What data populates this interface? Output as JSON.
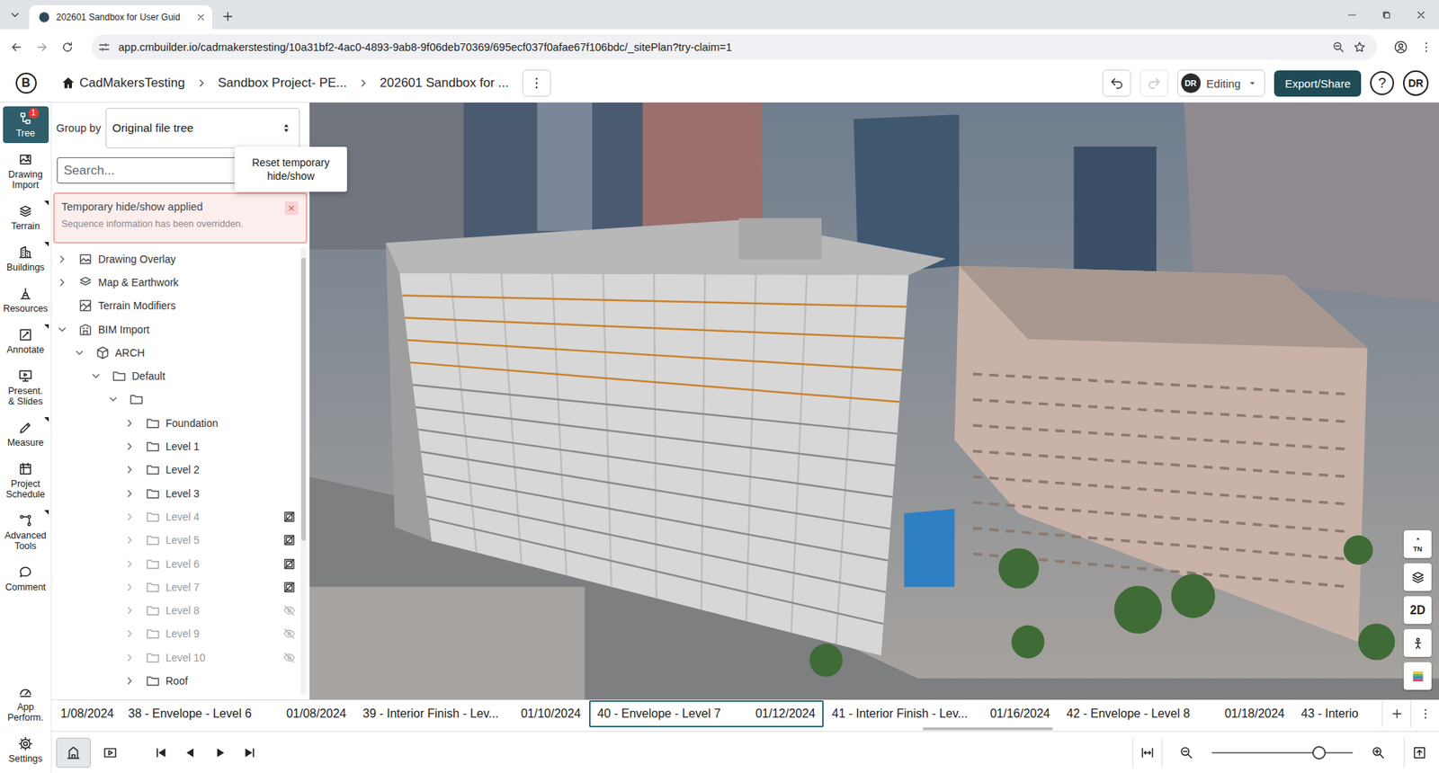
{
  "browser": {
    "tab_title": "202601 Sandbox for User Guid",
    "url": "app.cmbuilder.io/cadmakerstesting/10a31bf2-4ac0-4893-9ab8-9f06deb70369/695ecf037f0afae67f106bdc/_sitePlan?try-claim=1"
  },
  "header": {
    "logo": "B",
    "breadcrumbs": [
      "CadMakersTesting",
      "Sandbox Project- PE...",
      "202601 Sandbox for ..."
    ],
    "undo_enabled": true,
    "redo_enabled": false,
    "mode_initials": "DR",
    "mode": "Editing",
    "export_label": "Export/Share",
    "help_label": "?",
    "avatar": "DR"
  },
  "rail": {
    "top": [
      {
        "label": "Tree",
        "selected": true,
        "badge": "1",
        "has_menu": false
      },
      {
        "label": "Drawing Import",
        "selected": false,
        "badge": "",
        "has_menu": false
      },
      {
        "label": "Terrain",
        "selected": false,
        "badge": "",
        "has_menu": true
      },
      {
        "label": "Buildings",
        "selected": false,
        "badge": "",
        "has_menu": true
      },
      {
        "label": "Resources",
        "selected": false,
        "badge": "",
        "has_menu": false
      },
      {
        "label": "Annotate",
        "selected": false,
        "badge": "",
        "has_menu": true
      },
      {
        "label": "Present. & Slides",
        "selected": false,
        "badge": "",
        "has_menu": false
      },
      {
        "label": "Measure",
        "selected": false,
        "badge": "",
        "has_menu": true
      },
      {
        "label": "Project Schedule",
        "selected": false,
        "badge": "",
        "has_menu": false
      },
      {
        "label": "Advanced Tools",
        "selected": false,
        "badge": "",
        "has_menu": true
      },
      {
        "label": "Comment",
        "selected": false,
        "badge": "",
        "has_menu": false
      }
    ],
    "bottom": [
      {
        "label": "App Perform.",
        "selected": false,
        "badge": "",
        "has_menu": false
      },
      {
        "label": "Settings",
        "selected": false,
        "badge": "",
        "has_menu": false
      }
    ]
  },
  "tree_panel": {
    "group_by_label": "Group by",
    "group_by_value": "Original file tree",
    "search_placeholder": "Search...",
    "tooltip": "Reset temporary hide/show",
    "alert": {
      "title": "Temporary hide/show applied",
      "message": "Sequence information has been overridden."
    },
    "nodes": [
      {
        "label": "Drawing Overlay",
        "depth": 0,
        "kind": "overlay",
        "has_children": true,
        "expanded": false,
        "visibility": "shown"
      },
      {
        "label": "Map & Earthwork",
        "depth": 0,
        "kind": "map",
        "has_children": true,
        "expanded": false,
        "visibility": "shown"
      },
      {
        "label": "Terrain Modifiers",
        "depth": 0,
        "kind": "terrain",
        "has_children": false,
        "expanded": false,
        "visibility": "shown"
      },
      {
        "label": "BIM Import",
        "depth": 0,
        "kind": "bim",
        "has_children": true,
        "expanded": true,
        "visibility": "shown"
      },
      {
        "label": "ARCH",
        "depth": 1,
        "kind": "model",
        "has_children": true,
        "expanded": true,
        "visibility": "shown"
      },
      {
        "label": "Default",
        "depth": 2,
        "kind": "folder",
        "has_children": true,
        "expanded": true,
        "visibility": "shown"
      },
      {
        "label": "",
        "depth": 3,
        "kind": "folder",
        "has_children": true,
        "expanded": true,
        "visibility": "shown"
      },
      {
        "label": "Foundation",
        "depth": 4,
        "kind": "folder",
        "has_children": true,
        "expanded": false,
        "visibility": "shown"
      },
      {
        "label": "Level 1",
        "depth": 4,
        "kind": "folder",
        "has_children": true,
        "expanded": false,
        "visibility": "shown"
      },
      {
        "label": "Level 2",
        "depth": 4,
        "kind": "folder",
        "has_children": true,
        "expanded": false,
        "visibility": "shown"
      },
      {
        "label": "Level 3",
        "depth": 4,
        "kind": "folder",
        "has_children": true,
        "expanded": false,
        "visibility": "shown"
      },
      {
        "label": "Level 4",
        "depth": 4,
        "kind": "folder",
        "has_children": true,
        "expanded": false,
        "visibility": "overridden"
      },
      {
        "label": "Level 5",
        "depth": 4,
        "kind": "folder",
        "has_children": true,
        "expanded": false,
        "visibility": "overridden"
      },
      {
        "label": "Level 6",
        "depth": 4,
        "kind": "folder",
        "has_children": true,
        "expanded": false,
        "visibility": "overridden"
      },
      {
        "label": "Level 7",
        "depth": 4,
        "kind": "folder",
        "has_children": true,
        "expanded": false,
        "visibility": "overridden"
      },
      {
        "label": "Level 8",
        "depth": 4,
        "kind": "folder",
        "has_children": true,
        "expanded": false,
        "visibility": "hidden"
      },
      {
        "label": "Level 9",
        "depth": 4,
        "kind": "folder",
        "has_children": true,
        "expanded": false,
        "visibility": "hidden"
      },
      {
        "label": "Level 10",
        "depth": 4,
        "kind": "folder",
        "has_children": true,
        "expanded": false,
        "visibility": "hidden"
      },
      {
        "label": "Roof",
        "depth": 4,
        "kind": "folder",
        "has_children": true,
        "expanded": false,
        "visibility": "shown"
      }
    ]
  },
  "viewport": {
    "compass_label": "TN",
    "view_label": "2D"
  },
  "timeline": {
    "items": [
      {
        "label": "",
        "date": "1/08/2024",
        "selected": false,
        "kind": "start"
      },
      {
        "label": "38 - Envelope - Level 6",
        "date": "01/08/2024",
        "selected": false,
        "kind": "full"
      },
      {
        "label": "39 - Interior Finish - Lev...",
        "date": "01/10/2024",
        "selected": false,
        "kind": "full"
      },
      {
        "label": "40 - Envelope - Level 7",
        "date": "01/12/2024",
        "selected": true,
        "kind": "full"
      },
      {
        "label": "41 - Interior Finish - Lev...",
        "date": "01/16/2024",
        "selected": false,
        "kind": "full"
      },
      {
        "label": "42 - Envelope - Level 8",
        "date": "01/18/2024",
        "selected": false,
        "kind": "full"
      },
      {
        "label": "43 - Interio",
        "date": "",
        "selected": false,
        "kind": "end"
      }
    ]
  },
  "toolbar": {
    "modes": [
      {
        "selected": true
      },
      {
        "selected": false
      }
    ],
    "zoom_level": 0.76
  }
}
